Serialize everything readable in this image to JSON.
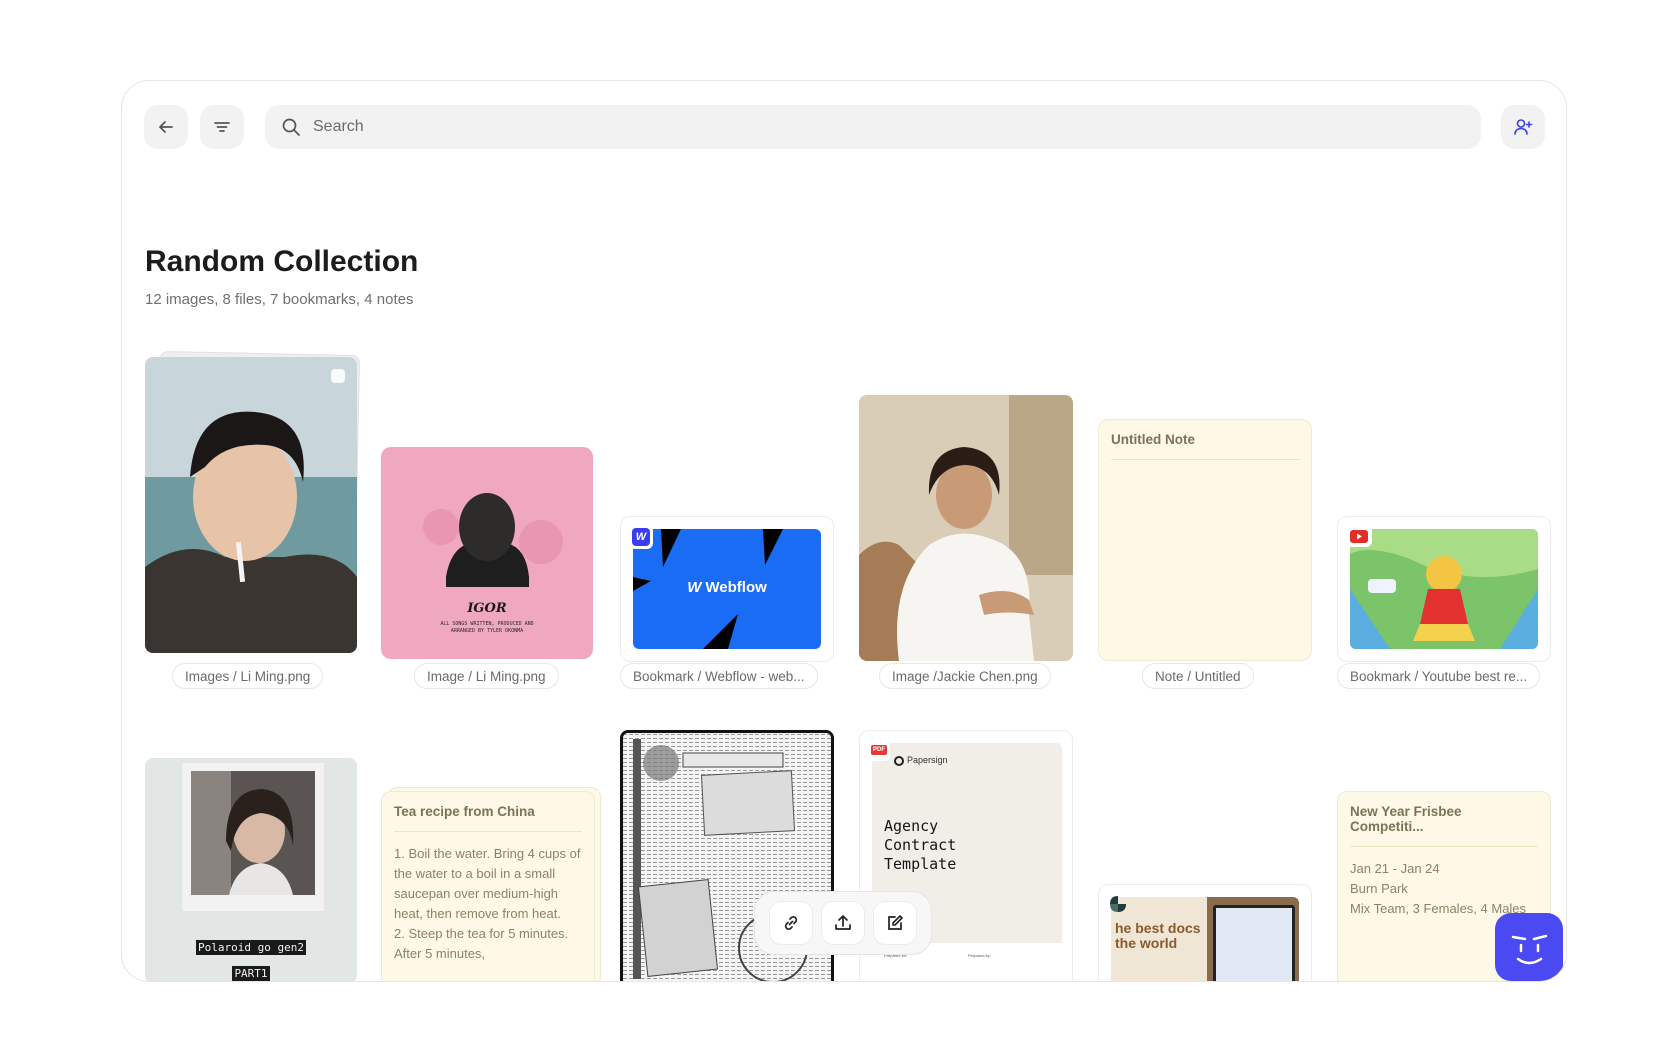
{
  "search": {
    "placeholder": "Search"
  },
  "collection": {
    "title": "Random Collection",
    "summary": "12 images, 8 files, 7 bookmarks, 4 notes"
  },
  "row1": {
    "labels": [
      "Images / Li Ming.png",
      "Image / Li Ming.png",
      "Bookmark / Webflow - web...",
      "Image /Jackie Chen.png",
      "Note / Untitled",
      "Bookmark / Youtube best re..."
    ],
    "webflow_text": "Webflow",
    "webflow_badge": "W",
    "album_title": "IGOR",
    "album_credits": "ALL SONGS WRITTEN, PRODUCED AND ARRANGED BY TYLER OKONMA",
    "untitled_note_title": "Untitled Note"
  },
  "row2": {
    "polaroid_caption_1": "Polaroid go gen2",
    "polaroid_caption_2": "PART1",
    "tea_note_title": "Tea recipe from China",
    "tea_note_body": "1. Boil the water. Bring 4 cups of the water to a boil in a small saucepan over medium-high heat, then remove from heat.\n2. Steep the tea for 5 minutes. After 5 minutes,",
    "pdf_badge": "PDF",
    "papersign_brand": "Papersign",
    "contract_title": "Agency Contract Template",
    "contract_footer_left": "Prepared for:",
    "contract_footer_right": "Prepared by:",
    "docs_text": "he best docs\nthe world",
    "frisbee_title": "New Year Frisbee Competiti...",
    "frisbee_lines": [
      "Jan 21 - Jan 24",
      "Burn Park",
      "Mix Team, 3 Females, 4 Males"
    ]
  },
  "colors": {
    "accent": "#4a49f2",
    "webflow_blue": "#1a6cf5",
    "note_bg": "#fdf9e6",
    "album_pink": "#f0a7c0"
  }
}
